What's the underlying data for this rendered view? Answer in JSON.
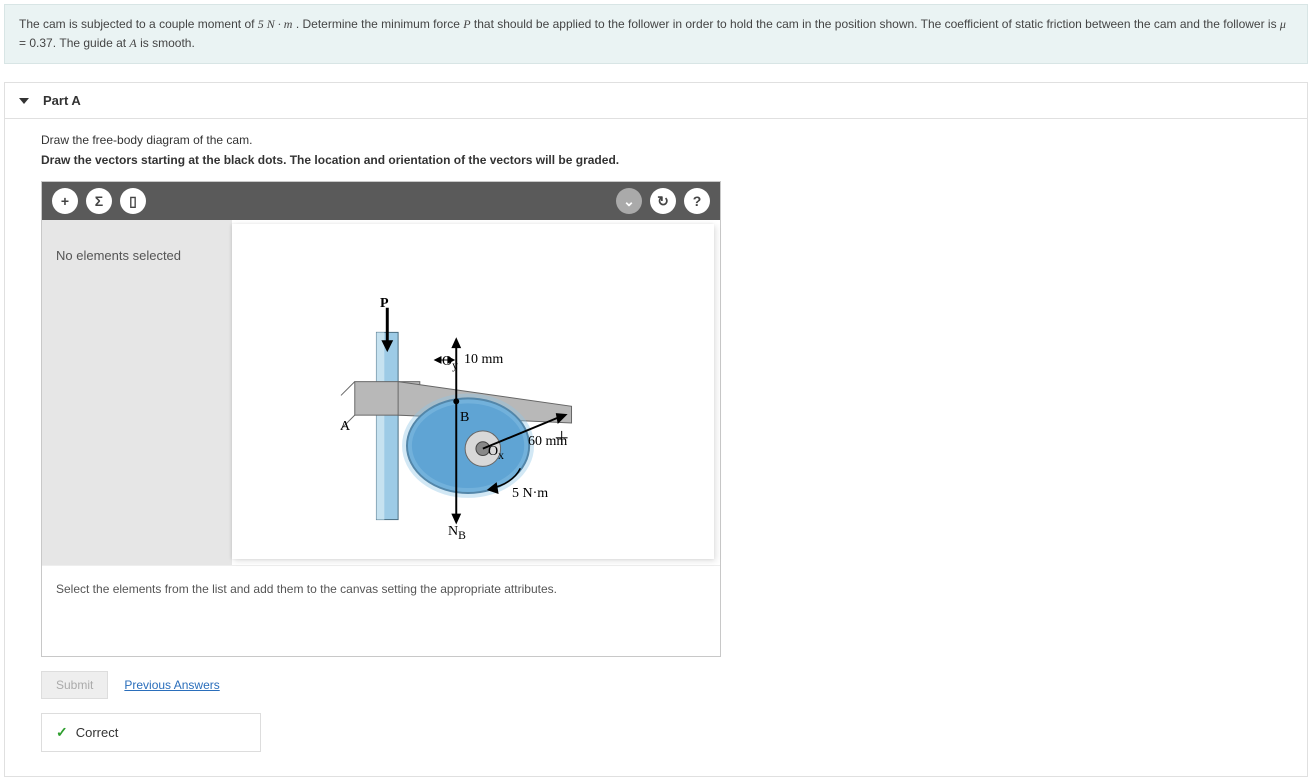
{
  "problem": {
    "pre": "The cam is subjected to a couple moment of ",
    "moment": "5 N · m",
    "mid1": ". Determine the minimum force ",
    "var_P": "P",
    "mid2": " that should be applied to the follower in order to hold the cam in the position shown. The coefficient of static friction between the cam and the follower is ",
    "mu": "μ",
    "mu_eq": " = 0.37. The guide at ",
    "var_A": "A",
    "post": " is smooth."
  },
  "part": {
    "title": "Part A",
    "instr1": "Draw the free-body diagram of the cam.",
    "instr2": "Draw the vectors starting at the black dots. The location and orientation of the vectors will be graded."
  },
  "toolbar": {
    "add": "+",
    "sigma": "Σ",
    "delete": "▯",
    "dropdown": "⌄",
    "refresh": "↻",
    "help": "?"
  },
  "sidebar": {
    "status": "No elements selected"
  },
  "diagram": {
    "P": "P",
    "A": "A",
    "B": "B",
    "Oy": "O",
    "Ox": "O",
    "NB": "N",
    "NB_sub": "B",
    "d10": "10 mm",
    "d60": "60 mm",
    "moment": "5 N·m"
  },
  "hint": "Select the elements from the list and add them to the canvas setting the appropriate attributes.",
  "actions": {
    "submit": "Submit",
    "previous": "Previous Answers"
  },
  "feedback": {
    "correct": "Correct"
  }
}
